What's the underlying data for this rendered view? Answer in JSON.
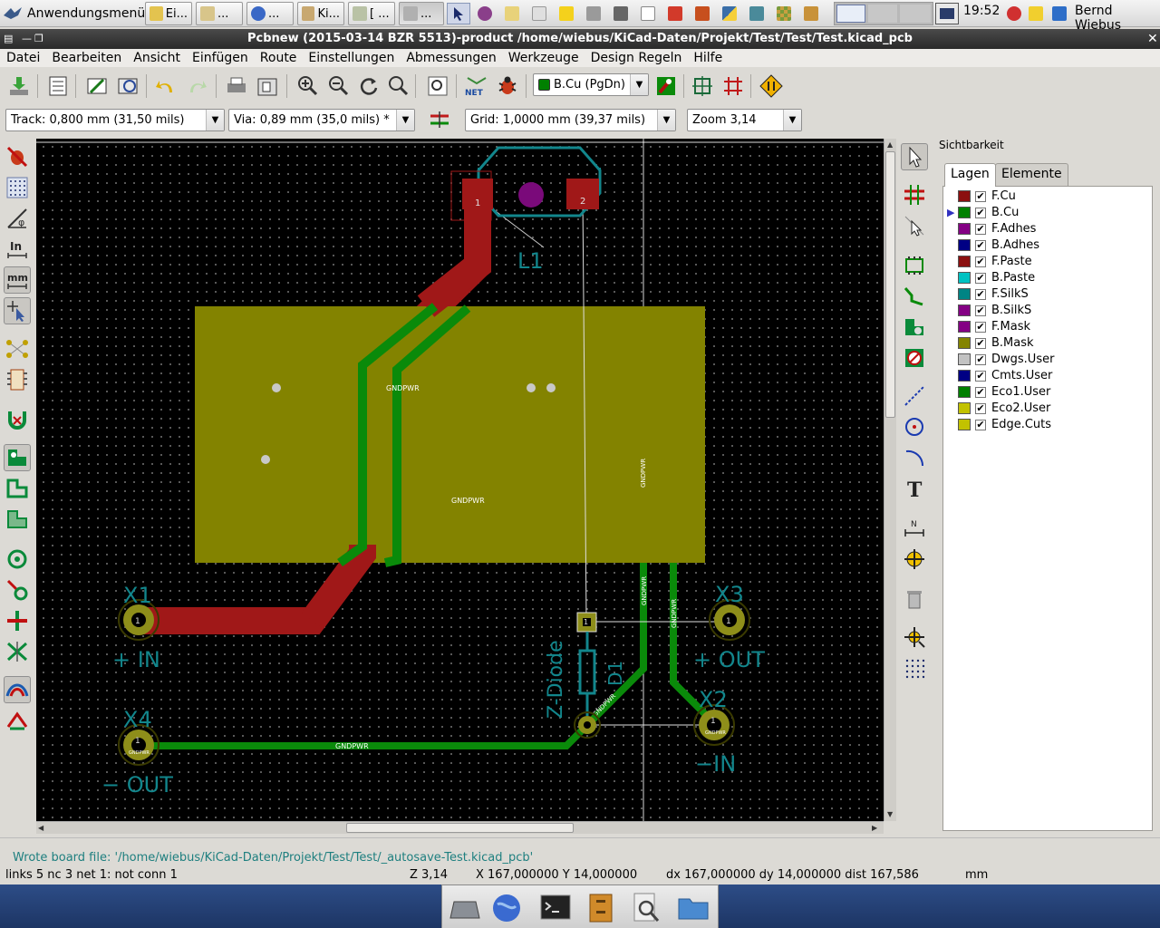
{
  "taskbar": {
    "app_menu": "Anwendungsmenü",
    "tasks": [
      "Ei...",
      "...",
      "...",
      "Ki...",
      "[ ...",
      "..."
    ],
    "clock": "19:52",
    "user": "Bernd Wiebus"
  },
  "window": {
    "title": "Pcbnew (2015-03-14 BZR 5513)-product /home/wiebus/KiCad-Daten/Projekt/Test/Test/Test.kicad_pcb"
  },
  "menu": [
    "Datei",
    "Bearbeiten",
    "Ansicht",
    "Einfügen",
    "Route",
    "Einstellungen",
    "Abmessungen",
    "Werkzeuge",
    "Design Regeln",
    "Hilfe"
  ],
  "toolbar": {
    "layer_select": "B.Cu (PgDn)",
    "layer_color": "#008000",
    "track": "Track: 0,800 mm (31,50 mils)",
    "via": "Via: 0,89 mm (35,0 mils) *",
    "grid": "Grid: 1,0000 mm (39,37 mils)",
    "zoom": "Zoom 3,14"
  },
  "pcb": {
    "refs": {
      "L1": "L1",
      "X1": "X1",
      "X2": "X2",
      "X3": "X3",
      "X4": "X4",
      "D1": "D1"
    },
    "values": {
      "in_plus": "+ IN",
      "out_plus": "+ OUT",
      "in_minus": "−IN",
      "out_minus": "− OUT",
      "diode": "Z-Diode"
    },
    "pads": {
      "one": "1",
      "two": "2"
    },
    "net": "GNDPWR",
    "colors": {
      "front_copper": "#a01818",
      "back_copper": "#0a8a0a",
      "zone": "#838300",
      "silk": "#12868c",
      "pad": "#8e8e1a"
    }
  },
  "panel": {
    "title": "Sichtbarkeit",
    "tabs": [
      "Lagen",
      "Elemente"
    ],
    "active_layer": "B.Cu",
    "layers": [
      {
        "name": "F.Cu",
        "color": "#8b1010",
        "checked": true
      },
      {
        "name": "B.Cu",
        "color": "#008000",
        "checked": true
      },
      {
        "name": "F.Adhes",
        "color": "#840084",
        "checked": true
      },
      {
        "name": "B.Adhes",
        "color": "#000084",
        "checked": true
      },
      {
        "name": "F.Paste",
        "color": "#8b1010",
        "checked": true
      },
      {
        "name": "B.Paste",
        "color": "#00c2c2",
        "checked": true
      },
      {
        "name": "F.SilkS",
        "color": "#008484",
        "checked": true
      },
      {
        "name": "B.SilkS",
        "color": "#840084",
        "checked": true
      },
      {
        "name": "F.Mask",
        "color": "#840084",
        "checked": true
      },
      {
        "name": "B.Mask",
        "color": "#848400",
        "checked": true
      },
      {
        "name": "Dwgs.User",
        "color": "#c2c2c2",
        "checked": true
      },
      {
        "name": "Cmts.User",
        "color": "#000084",
        "checked": true
      },
      {
        "name": "Eco1.User",
        "color": "#008000",
        "checked": true
      },
      {
        "name": "Eco2.User",
        "color": "#c2c200",
        "checked": true
      },
      {
        "name": "Edge.Cuts",
        "color": "#c2c200",
        "checked": true
      }
    ]
  },
  "messages": {
    "last": "Wrote board file: '/home/wiebus/KiCad-Daten/Projekt/Test/Test/_autosave-Test.kicad_pcb'"
  },
  "status": {
    "links": "links 5 nc 3  net 1: not conn 1",
    "zoom": "Z 3,14",
    "xy": "X 167,000000  Y 14,000000",
    "dxy": "dx 167,000000 dy 14,000000 dist 167,586",
    "units": "mm"
  }
}
